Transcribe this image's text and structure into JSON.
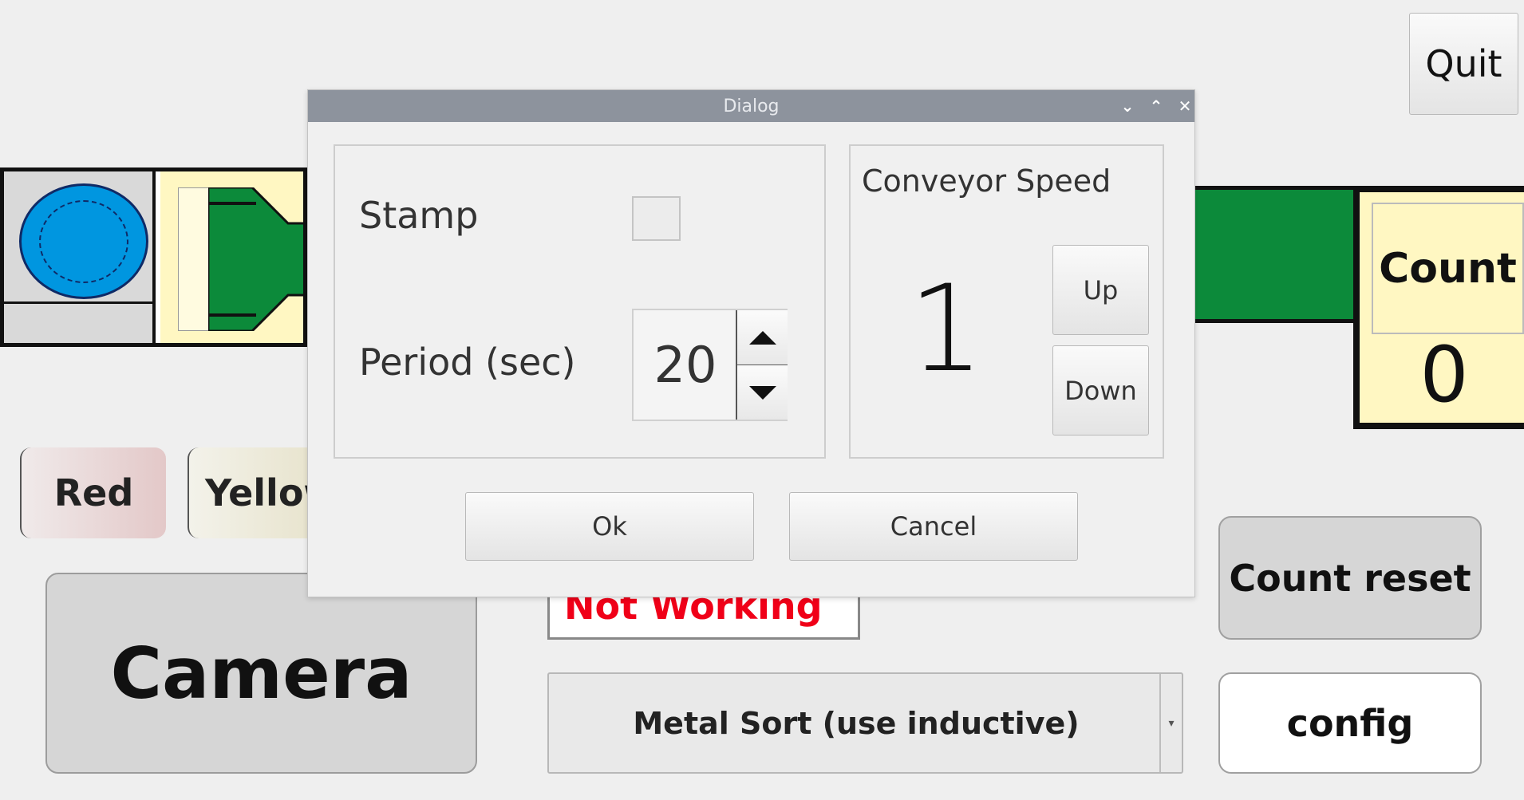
{
  "app": {
    "quit_label": "Quit",
    "count_label": "Count",
    "count_value": "0",
    "sort_buttons": {
      "red_label": "Red",
      "yellow_label": "Yellow"
    },
    "camera_label": "Camera",
    "status_text": "Not Working",
    "mode_select": {
      "selected": "Metal Sort (use inductive)"
    },
    "count_reset_label": "Count reset",
    "config_label": "config"
  },
  "dialog": {
    "title": "Dialog",
    "window_controls": {
      "minimize": "⌄",
      "maximize": "⌃",
      "close": "✕"
    },
    "stamp_label": "Stamp",
    "stamp_checked": false,
    "period_label": "Period (sec)",
    "period_value": "20",
    "speed_title": "Conveyor Speed",
    "speed_value": "1",
    "up_label": "Up",
    "down_label": "Down",
    "ok_label": "Ok",
    "cancel_label": "Cancel"
  },
  "colors": {
    "belt_green": "#0c8a3a",
    "belt_yellow": "#fff7c2",
    "disc_blue": "#0096e0",
    "status_red": "#f00018",
    "titlebar": "#8d939d"
  }
}
